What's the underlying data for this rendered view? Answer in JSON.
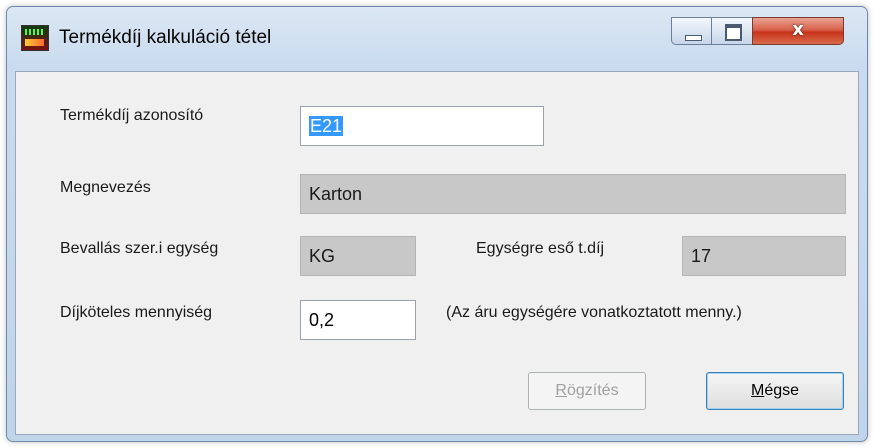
{
  "window": {
    "title": "Termékdíj kalkuláció tétel",
    "icon": "app-icon",
    "controls": {
      "minimize": "minimize-icon",
      "maximize": "maximize-icon",
      "close": "x"
    }
  },
  "form": {
    "id_label": "Termékdíj azonosító",
    "id_value": "E21",
    "name_label": "Megnevezés",
    "name_value": "Karton",
    "unit_label": "Bevallás szer.i  egység",
    "unit_value": "KG",
    "fee_label": "Egységre eső t.díj",
    "fee_value": "17",
    "qty_label": "Díjköteles mennyiség",
    "qty_value": "0,2",
    "qty_note": "(Az áru egységére vonatkoztatott menny.)"
  },
  "buttons": {
    "save": {
      "mnemonic": "R",
      "rest": "ögzítés",
      "enabled": false
    },
    "cancel": {
      "mnemonic": "M",
      "rest": "égse",
      "enabled": true
    }
  }
}
